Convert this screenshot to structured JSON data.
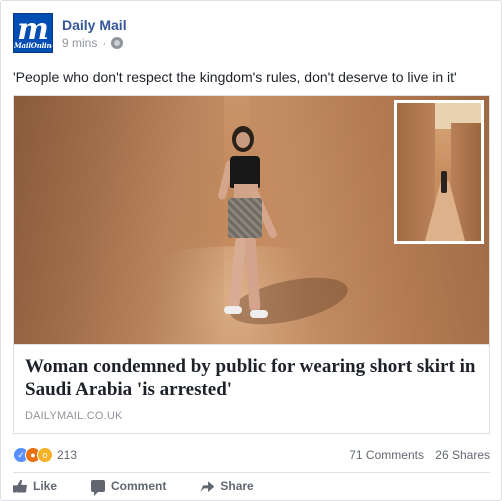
{
  "page": {
    "name": "Daily Mail",
    "logo_text": "m",
    "logo_subtext": "MailOnline",
    "time": "9 mins",
    "separator": "·"
  },
  "post": {
    "text": "'People who don't respect the kingdom's rules, don't deserve to live in it'"
  },
  "link": {
    "title": "Woman condemned by public for wearing short skirt in Saudi Arabia 'is arrested'",
    "domain": "DAILYMAIL.CO.UK"
  },
  "reactions": {
    "types": [
      "like-icon",
      "angry-icon",
      "wow-icon"
    ],
    "count": "213",
    "comments": "71 Comments",
    "shares": "26 Shares"
  },
  "actions": {
    "like": "Like",
    "comment": "Comment",
    "share": "Share"
  },
  "colors": {
    "link": "#365899",
    "meta": "#90949c",
    "like": "#5890ff"
  }
}
